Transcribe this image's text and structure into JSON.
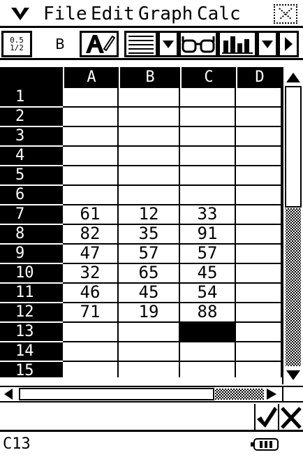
{
  "menu": {
    "items": [
      "File",
      "Edit",
      "Graph",
      "Calc"
    ]
  },
  "toolbar": {
    "fraction_label": "0.5 1/2",
    "bold_label": "B"
  },
  "grid": {
    "columns": [
      "A",
      "B",
      "C",
      "D"
    ],
    "rows": [
      {
        "n": "1",
        "cells": [
          "",
          "",
          "",
          ""
        ]
      },
      {
        "n": "2",
        "cells": [
          "",
          "",
          "",
          ""
        ]
      },
      {
        "n": "3",
        "cells": [
          "",
          "",
          "",
          ""
        ]
      },
      {
        "n": "4",
        "cells": [
          "",
          "",
          "",
          ""
        ]
      },
      {
        "n": "5",
        "cells": [
          "",
          "",
          "",
          ""
        ]
      },
      {
        "n": "6",
        "cells": [
          "",
          "",
          "",
          ""
        ]
      },
      {
        "n": "7",
        "cells": [
          "61",
          "12",
          "33",
          ""
        ]
      },
      {
        "n": "8",
        "cells": [
          "82",
          "35",
          "91",
          ""
        ]
      },
      {
        "n": "9",
        "cells": [
          "47",
          "57",
          "57",
          ""
        ]
      },
      {
        "n": "10",
        "cells": [
          "32",
          "65",
          "45",
          ""
        ]
      },
      {
        "n": "11",
        "cells": [
          "46",
          "45",
          "54",
          ""
        ]
      },
      {
        "n": "12",
        "cells": [
          "71",
          "19",
          "88",
          ""
        ]
      },
      {
        "n": "13",
        "cells": [
          "",
          "",
          "",
          ""
        ]
      },
      {
        "n": "14",
        "cells": [
          "",
          "",
          "",
          ""
        ]
      },
      {
        "n": "15",
        "cells": [
          "",
          "",
          "",
          ""
        ]
      }
    ],
    "selected_cell": "C13"
  },
  "status": {
    "cell_ref": "C13"
  }
}
